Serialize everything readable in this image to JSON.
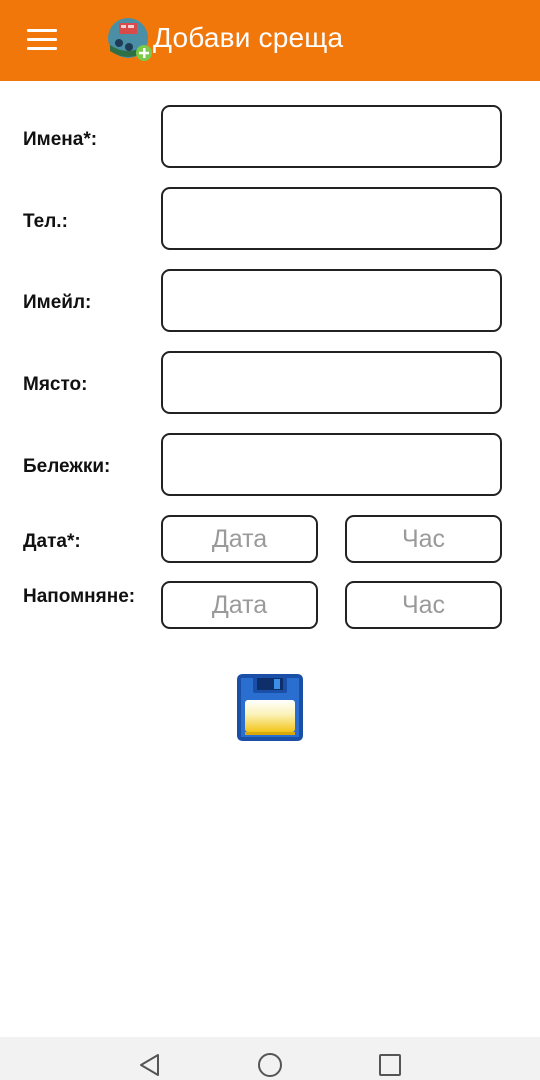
{
  "header": {
    "title": "Добави среща",
    "menu_icon": "menu-icon",
    "logo_icon": "meeting-add-icon",
    "bg_color": "#f2770a"
  },
  "form": {
    "names_label": "Имена*:",
    "phone_label": "Тел.:",
    "email_label": "Имейл:",
    "place_label": "Място:",
    "notes_label": "Бележки:",
    "date_label": "Дата*:",
    "reminder_label": "Напомняне:",
    "names_value": "",
    "phone_value": "",
    "email_value": "",
    "place_value": "",
    "notes_value": "",
    "date_picker": "Дата",
    "time_picker": "Час",
    "reminder_date_picker": "Дата",
    "reminder_time_picker": "Час"
  },
  "actions": {
    "save_icon": "floppy-disk-icon"
  },
  "navbar": {
    "back_icon": "back-triangle-icon",
    "home_icon": "home-circle-icon",
    "recents_icon": "recents-square-icon"
  }
}
